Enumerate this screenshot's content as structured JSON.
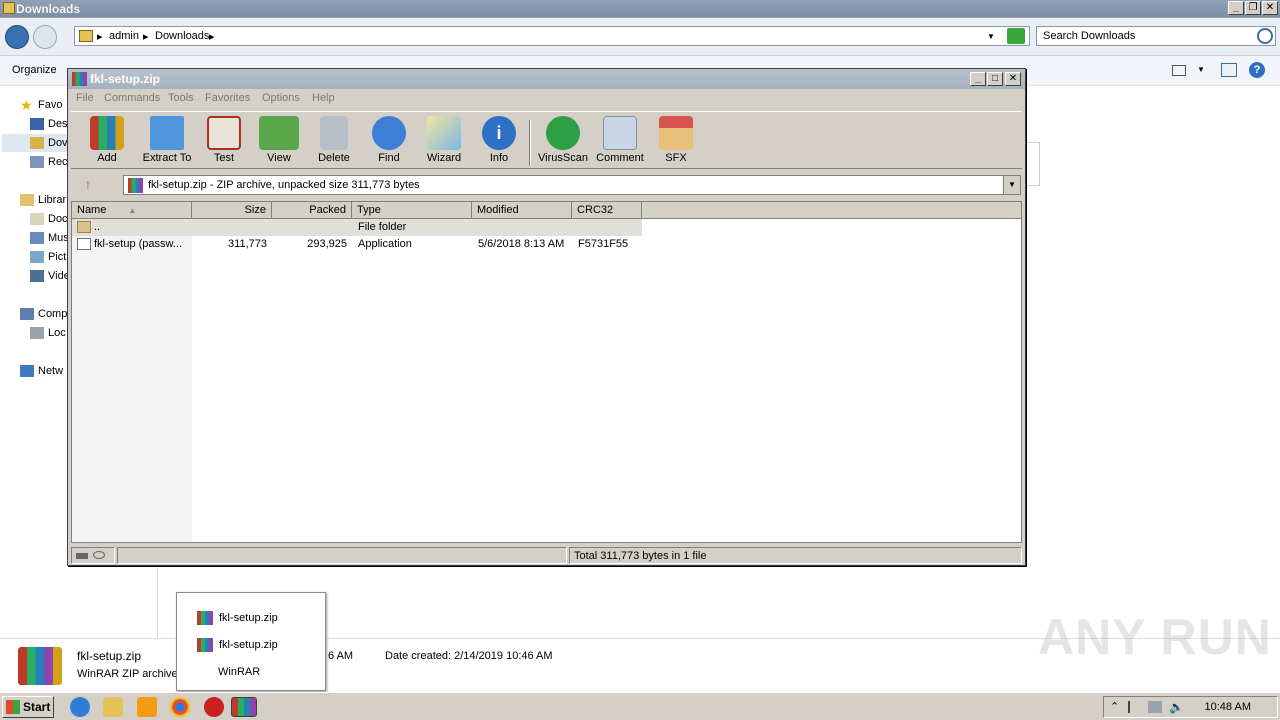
{
  "explorer": {
    "title": "Downloads",
    "breadcrumb": [
      "admin",
      "Downloads"
    ],
    "search_placeholder": "Search Downloads",
    "organize_label": "Organize",
    "nav": [
      {
        "label": "Favo",
        "icon": "star-icon"
      },
      {
        "label": "Des",
        "icon": "desktop-icon"
      },
      {
        "label": "Dov",
        "icon": "downloads-icon"
      },
      {
        "label": "Rec",
        "icon": "recent-icon"
      },
      {
        "label": "Librar",
        "icon": "library-icon"
      },
      {
        "label": "Doc",
        "icon": "documents-icon"
      },
      {
        "label": "Mus",
        "icon": "music-icon"
      },
      {
        "label": "Pict",
        "icon": "pictures-icon"
      },
      {
        "label": "Vide",
        "icon": "videos-icon"
      },
      {
        "label": "Comp",
        "icon": "computer-icon"
      },
      {
        "label": "Loc",
        "icon": "disk-icon"
      },
      {
        "label": "Netw",
        "icon": "network-icon"
      }
    ],
    "details": {
      "filename": "fkl-setup.zip",
      "filetype": "WinRAR ZIP archive",
      "partial_time": "6 AM",
      "date_created": "Date created: 2/14/2019 10:46 AM"
    }
  },
  "winrar": {
    "title": "fkl-setup.zip",
    "menu": [
      "File",
      "Commands",
      "Tools",
      "Favorites",
      "Options",
      "Help"
    ],
    "tools": [
      "Add",
      "Extract To",
      "Test",
      "View",
      "Delete",
      "Find",
      "Wizard",
      "Info",
      "VirusScan",
      "Comment",
      "SFX"
    ],
    "path_text": "fkl-setup.zip - ZIP archive, unpacked size 311,773 bytes",
    "columns": [
      "Name",
      "Size",
      "Packed",
      "Type",
      "Modified",
      "CRC32"
    ],
    "rows": [
      {
        "name": "..",
        "size": "",
        "packed": "",
        "type": "File folder",
        "modified": "",
        "crc": ""
      },
      {
        "name": "fkl-setup (passw...",
        "size": "311,773",
        "packed": "293,925",
        "type": "Application",
        "modified": "5/6/2018 8:13 AM",
        "crc": "F5731F55"
      }
    ],
    "status_total": "Total 311,773 bytes in 1 file"
  },
  "popup": {
    "items": [
      "fkl-setup.zip",
      "fkl-setup.zip",
      "WinRAR"
    ]
  },
  "taskbar": {
    "start_label": "Start",
    "clock": "10:48 AM"
  },
  "watermark": "ANY RUN"
}
